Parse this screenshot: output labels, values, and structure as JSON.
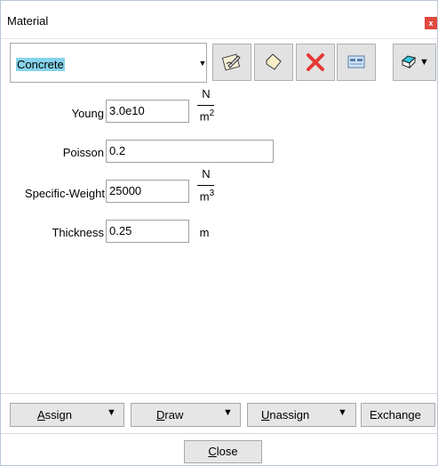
{
  "window": {
    "title": "Material",
    "close_glyph": "x"
  },
  "material_select": {
    "value": "Concrete",
    "arrow": "▼"
  },
  "toolbar": {
    "icons": [
      "edit-material-icon",
      "new-material-icon",
      "delete-icon",
      "properties-icon",
      "layer-menu-icon"
    ],
    "menu_arrow": "▼"
  },
  "fields": {
    "young": {
      "label": "Young",
      "value": "3.0e10",
      "unit_num": "N",
      "unit_den": "m",
      "unit_exp": "2"
    },
    "poisson": {
      "label": "Poisson",
      "value": "0.2"
    },
    "specific_weight": {
      "label": "Specific-Weight",
      "value": "25000",
      "unit_num": "N",
      "unit_den": "m",
      "unit_exp": "3"
    },
    "thickness": {
      "label": "Thickness",
      "value": "0.25",
      "unit": "m"
    }
  },
  "actions": {
    "assign": {
      "first": "A",
      "rest": "ssign",
      "arrow": "▼"
    },
    "draw": {
      "first": "D",
      "rest": "raw",
      "arrow": "▼"
    },
    "unassign": {
      "first": "U",
      "rest": "nassign",
      "arrow": "▼"
    },
    "exchange": "Exchange"
  },
  "close": {
    "first": "C",
    "rest": "lose"
  },
  "colors": {
    "selection": "#86d3ea",
    "close_red": "#e0483e",
    "delete_red": "#e53935"
  }
}
